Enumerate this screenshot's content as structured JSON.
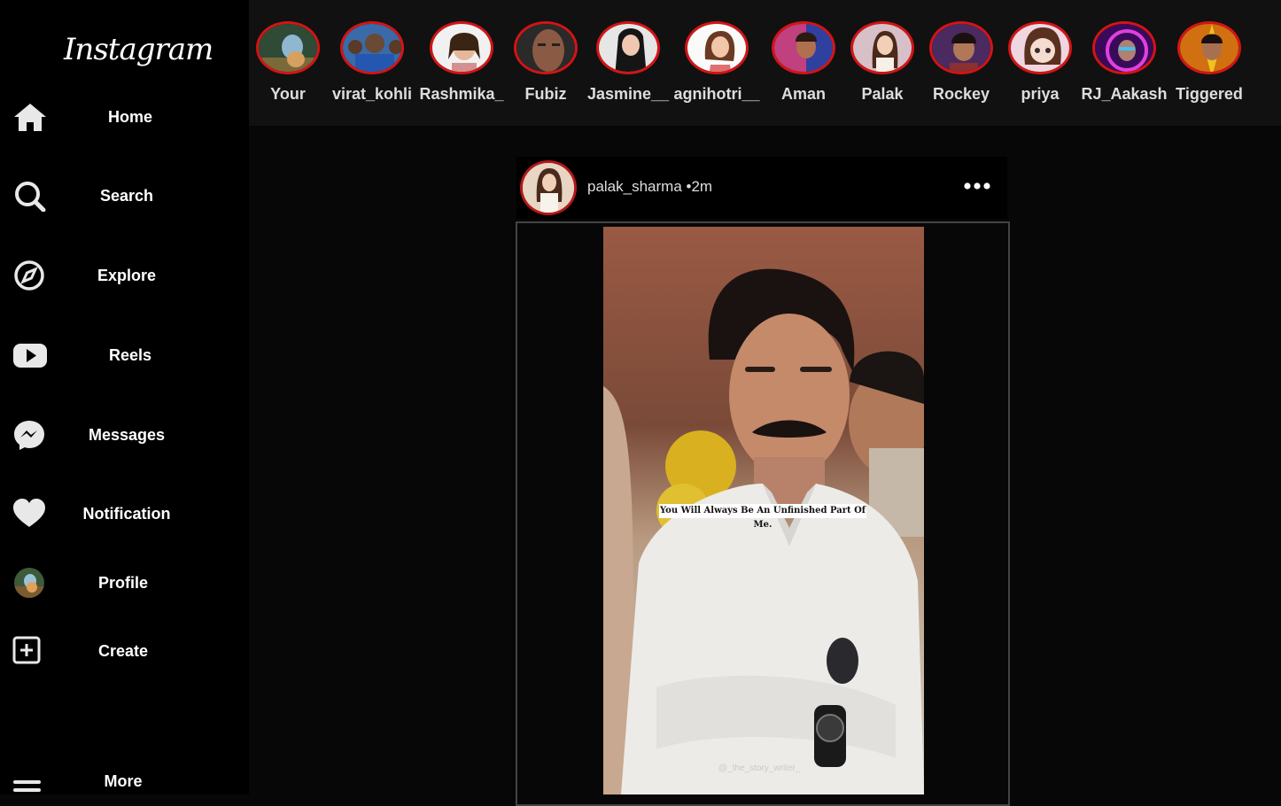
{
  "app": {
    "logo_text": "Instagram"
  },
  "sidebar": {
    "items": [
      {
        "label": "Home",
        "icon": "home-icon"
      },
      {
        "label": "Search",
        "icon": "search-icon"
      },
      {
        "label": "Explore",
        "icon": "compass-icon"
      },
      {
        "label": "Reels",
        "icon": "youtube-icon"
      },
      {
        "label": "Messages",
        "icon": "messenger-icon"
      },
      {
        "label": "Notification",
        "icon": "heart-icon"
      },
      {
        "label": "Profile",
        "icon": "avatar"
      },
      {
        "label": "Create",
        "icon": "plus-square-icon"
      },
      {
        "label": "More",
        "icon": "menu-icon"
      }
    ]
  },
  "stories": [
    {
      "label": "Your"
    },
    {
      "label": "virat_kohli"
    },
    {
      "label": "Rashmika_"
    },
    {
      "label": "Fubiz"
    },
    {
      "label": "Jasmine__"
    },
    {
      "label": "agnihotri__"
    },
    {
      "label": "Aman"
    },
    {
      "label": "Palak"
    },
    {
      "label": "Rockey"
    },
    {
      "label": "priya"
    },
    {
      "label": "RJ_Aakash"
    },
    {
      "label": "Tiggered"
    }
  ],
  "post": {
    "username": "palak_sharma",
    "time": "•2m",
    "caption": "You Will Always Be An Unfinished Part Of Me.",
    "watermark": "@_the_story_writer_"
  },
  "colors": {
    "story_ring": "#d41414",
    "background": "#070707",
    "sidebar": "#000000"
  }
}
